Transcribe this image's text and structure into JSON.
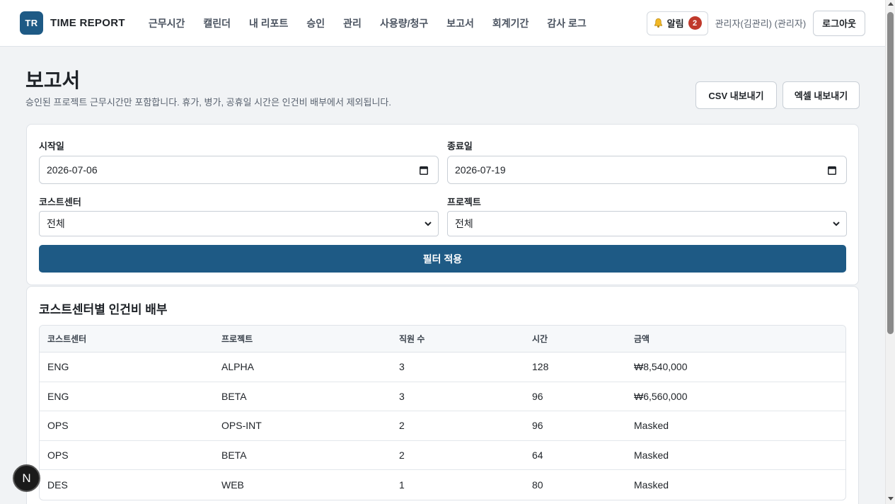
{
  "brand": {
    "badge": "TR",
    "name": "TIME REPORT"
  },
  "nav": {
    "items": [
      "근무시간",
      "캘린더",
      "내 리포트",
      "승인",
      "관리",
      "사용량/청구",
      "보고서",
      "회계기간",
      "감사 로그"
    ]
  },
  "header_right": {
    "alert_label": "알림",
    "alert_count": "2",
    "user": "관리자(김관리) (관리자)",
    "logout": "로그아웃"
  },
  "page": {
    "title": "보고서",
    "description": "승인된 프로젝트 근무시간만 포함합니다. 휴가, 병가, 공휴일 시간은 인건비 배부에서 제외됩니다.",
    "export_csv": "CSV 내보내기",
    "export_excel": "엑셀 내보내기"
  },
  "filters": {
    "start_label": "시작일",
    "start_value": "2026-07-06",
    "end_label": "종료일",
    "end_value": "2026-07-19",
    "costcenter_label": "코스트센터",
    "costcenter_value": "전체",
    "project_label": "프로젝트",
    "project_value": "전체",
    "apply": "필터 적용"
  },
  "table": {
    "title": "코스트센터별 인건비 배부",
    "columns": [
      "코스트센터",
      "프로젝트",
      "직원 수",
      "시간",
      "금액"
    ],
    "rows": [
      [
        "ENG",
        "ALPHA",
        "3",
        "128",
        "₩8,540,000"
      ],
      [
        "ENG",
        "BETA",
        "3",
        "96",
        "₩6,560,000"
      ],
      [
        "OPS",
        "OPS-INT",
        "2",
        "96",
        "Masked"
      ],
      [
        "OPS",
        "BETA",
        "2",
        "64",
        "Masked"
      ],
      [
        "DES",
        "WEB",
        "1",
        "80",
        "Masked"
      ]
    ]
  },
  "fab": {
    "label": "N"
  },
  "colors": {
    "primary": "#1e5a85",
    "alert_badge": "#c0392b"
  }
}
